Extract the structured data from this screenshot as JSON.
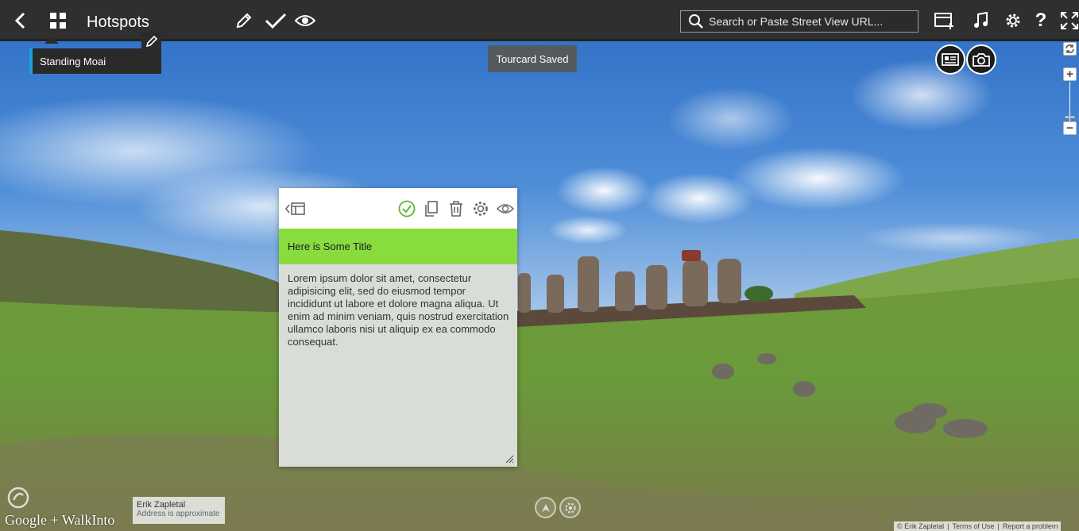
{
  "toolbar": {
    "title": "Hotspots",
    "search_placeholder": "Search or Paste Street View URL...",
    "icons": {
      "back": "chevron-left-icon",
      "grid": "grid-icon",
      "edit": "pencil-icon",
      "check": "checkmark-icon",
      "preview": "eye-icon",
      "search": "search-icon",
      "add_scene": "add-scene-icon",
      "music": "music-note-icon",
      "settings": "gear-icon",
      "help": "help-icon",
      "fullscreen": "fullscreen-icon"
    }
  },
  "hotspot_menu": {
    "item_label": "Standing Moai"
  },
  "toast": {
    "text": "Tourcard Saved"
  },
  "tourcard": {
    "title": "Here is Some Title",
    "body": "Lorem ipsum dolor sit amet, consectetur adipisicing elit, sed do eiusmod tempor incididunt ut labore et dolore magna aliqua. Ut enim ad minim veniam, quis nostrud exercitation ullamco laboris nisi ut aliquip ex ea commodo consequat."
  },
  "attribution": {
    "logo_text": "Google + WalkInto",
    "author": "Erik Zapletal",
    "address_note": "Address is approximate",
    "copyright": "© Erik Zapletal",
    "terms": "Terms of Use",
    "report": "Report a problem"
  },
  "colors": {
    "toolbar_bg": "#2f2f2f",
    "accent_green": "#89dc3d",
    "accent_blue": "#1ba0d7",
    "card_body_bg": "#d9ddd8"
  }
}
